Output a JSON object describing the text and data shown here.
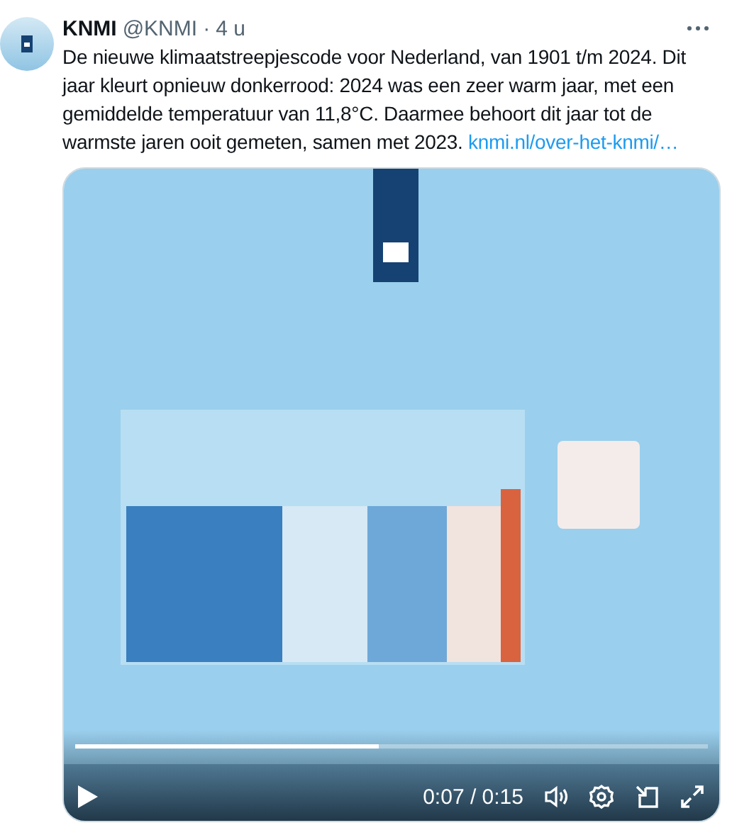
{
  "author": {
    "name": "KNMI",
    "handle": "@KNMI",
    "separator": "·",
    "time": "4 u"
  },
  "text": "De nieuwe klimaatstreepjescode voor Nederland, van 1901 t/m 2024. Dit jaar kleurt opnieuw donkerrood: 2024 was een zeer warm jaar, met een gemiddelde temperatuur van 11,8°C. Daarmee behoort dit jaar tot de warmste jaren ooit gemeten, samen met 2023.",
  "link": "knmi.nl/over-het-knmi/…",
  "video": {
    "kind": "picture",
    "progress": {
      "level": 0.48
    },
    "time": "0:07 / 0:15"
  }
}
